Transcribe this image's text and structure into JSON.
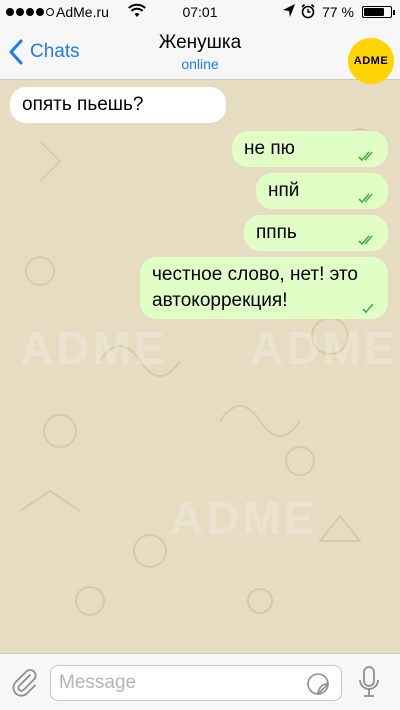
{
  "status_bar": {
    "carrier": "AdMe.ru",
    "time": "07:01",
    "battery": "77 %",
    "battery_level": 0.77
  },
  "nav": {
    "back_label": "Chats",
    "title": "Женушка",
    "status": "online",
    "avatar_text": "ADME"
  },
  "messages": [
    {
      "direction": "in",
      "text": "опять пьешь?"
    },
    {
      "direction": "out",
      "text": "не пю",
      "status": "read"
    },
    {
      "direction": "out",
      "text": "нпй",
      "status": "read"
    },
    {
      "direction": "out",
      "text": "пппь",
      "status": "read"
    },
    {
      "direction": "out",
      "text_line1": "честное слово, нет! это",
      "text_line2": "автокоррекция!",
      "status": "delivered"
    }
  ],
  "input": {
    "placeholder": "Message"
  },
  "watermark": "ADME",
  "colors": {
    "accent": "#1a7cf6",
    "incoming_bubble": "#ffffff",
    "outgoing_bubble": "#e1fec6",
    "chat_background": "#e6dcc2",
    "check": "#3fb53f",
    "avatar": "#ffd400"
  }
}
